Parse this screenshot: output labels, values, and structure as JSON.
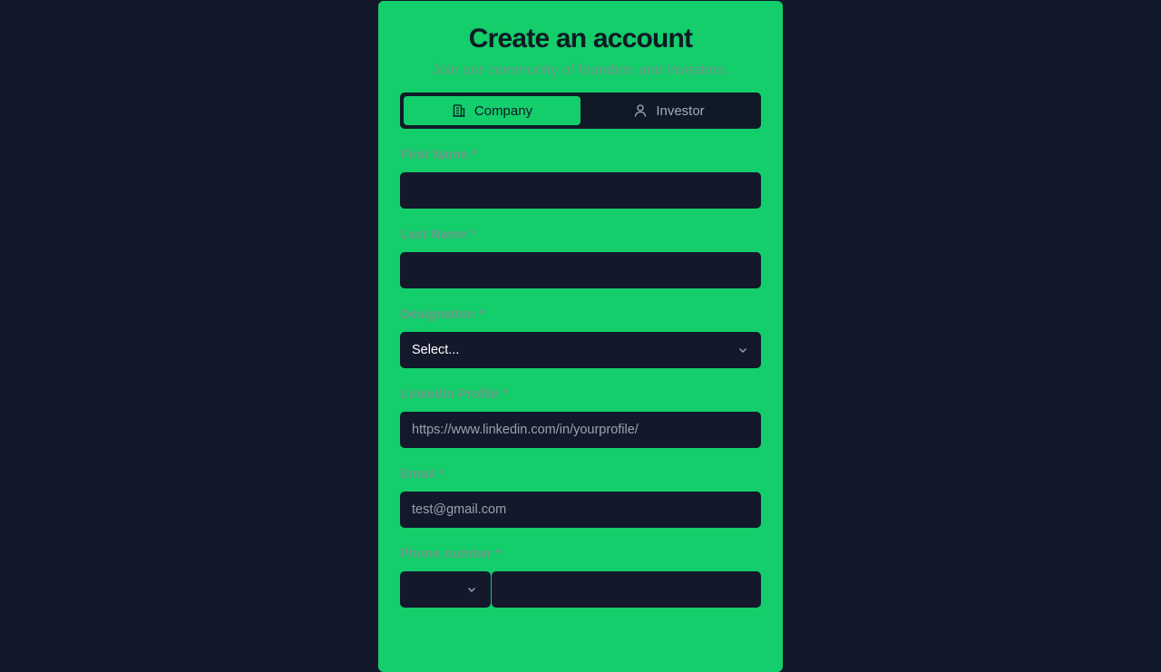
{
  "header": {
    "title": "Create an account",
    "subtitle": "Join our community of founders and investors."
  },
  "account_type": {
    "selected": "Company",
    "options": [
      {
        "label": "Company",
        "icon": "building-icon"
      },
      {
        "label": "Investor",
        "icon": "user-icon"
      }
    ]
  },
  "form": {
    "first_name": {
      "label": "First Name *",
      "value": ""
    },
    "last_name": {
      "label": "Last Name *",
      "value": ""
    },
    "designation": {
      "label": "Designation *",
      "value": "Select..."
    },
    "linkedin": {
      "label": "LinkedIn Profile *",
      "placeholder": "https://www.linkedin.com/in/yourprofile/"
    },
    "email": {
      "label": "Email *",
      "placeholder": "test@gmail.com"
    },
    "phone": {
      "label": "Phone number *",
      "country_code": "",
      "value": ""
    }
  },
  "colors": {
    "background": "#13182b",
    "card": "#13ce6b",
    "input": "#14182b",
    "label": "#6d9a8a"
  }
}
